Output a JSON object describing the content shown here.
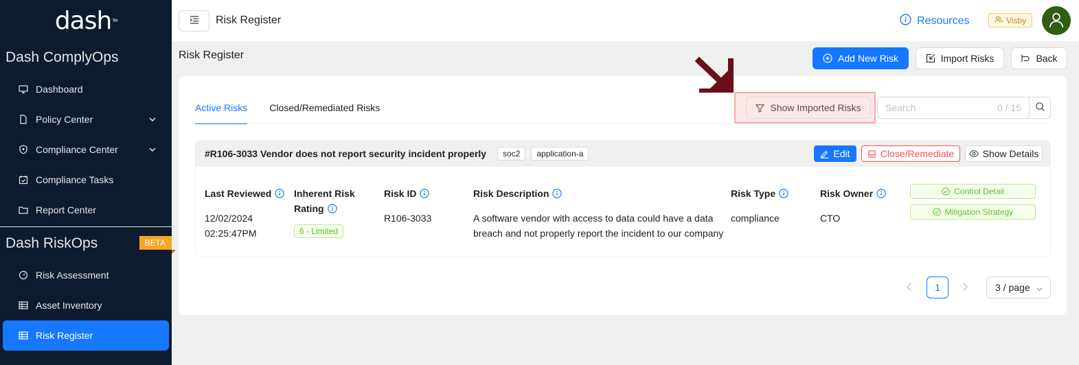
{
  "sidebar": {
    "logo": "dash",
    "logo_tm": "TM",
    "section1": "Dash ComplyOps",
    "items1": [
      {
        "label": "Dashboard",
        "icon": "monitor-icon"
      },
      {
        "label": "Policy Center",
        "icon": "file-icon",
        "expandable": true
      },
      {
        "label": "Compliance Center",
        "icon": "shield-icon",
        "expandable": true
      },
      {
        "label": "Compliance Tasks",
        "icon": "calendar-check-icon"
      },
      {
        "label": "Report Center",
        "icon": "folder-icon"
      }
    ],
    "section2": "Dash RiskOps",
    "beta": "BETA",
    "items2": [
      {
        "label": "Risk Assessment",
        "icon": "dashboard-gauge-icon"
      },
      {
        "label": "Asset Inventory",
        "icon": "table-icon"
      },
      {
        "label": "Risk Register",
        "icon": "table-icon",
        "active": true
      }
    ]
  },
  "header": {
    "title": "Risk Register",
    "resources": "Resources",
    "org": "Visby"
  },
  "main": {
    "title": "Risk Register",
    "add_btn": "Add New Risk",
    "import_btn": "Import Risks",
    "back_btn": "Back",
    "tabs": [
      "Active Risks",
      "Closed/Remediated Risks"
    ],
    "show_imported": "Show Imported Risks",
    "search_placeholder": "Search",
    "search_count": "0 / 15"
  },
  "risk": {
    "title": "#R106-3033 Vendor does not report security incident properly",
    "tags": [
      "soc2",
      "application-a"
    ],
    "edit": "Edit",
    "close": "Close/Remediate",
    "details": "Show Details",
    "columns": {
      "last_reviewed_label": "Last Reviewed",
      "last_reviewed_date": "12/02/2024",
      "last_reviewed_time": "02:25:47PM",
      "inherent_label_1": "Inherent Risk",
      "inherent_label_2": "Rating",
      "inherent_value": "6 - Limited",
      "risk_id_label": "Risk ID",
      "risk_id": "R106-3033",
      "desc_label": "Risk Description",
      "desc_line1": "A software vendor with access to data could have a data",
      "desc_line2": "breach and not properly report the incident to our company",
      "type_label": "Risk Type",
      "type": "compliance",
      "owner_label": "Risk Owner",
      "owner": "CTO"
    },
    "control_detail": "Control Detail",
    "mitigation": "Mitigation Strategy"
  },
  "pagination": {
    "current": "1",
    "page_size": "3 / page"
  },
  "colors": {
    "sidebar_bg": "#0d1b2e",
    "primary": "#1677ff",
    "danger": "#ff4d4f",
    "success": "#52c41a",
    "beta": "#f5a623",
    "annotation_arrow": "#6b0f1a"
  }
}
